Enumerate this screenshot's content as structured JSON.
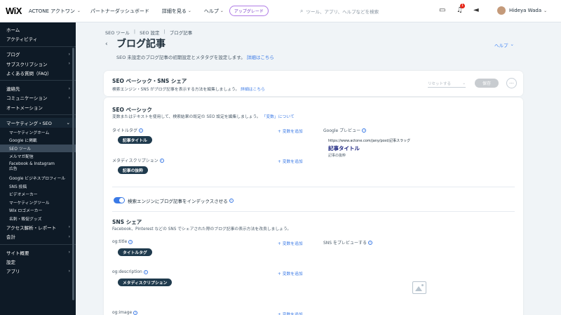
{
  "topbar": {
    "logo": "WiX",
    "site_name": "ACTONE アクトワン",
    "nav": [
      "パートナーダッシュボード",
      "詳細を見る",
      "ヘルプ"
    ],
    "upgrade": "アップグレード",
    "search_placeholder": "ツール、アプリ、ヘルプなどを検索",
    "notification_count": "1",
    "username": "Hideya Wada"
  },
  "sidebar": {
    "top": [
      {
        "label": "ホーム",
        "arrow": ""
      },
      {
        "label": "アクティビティ",
        "arrow": ""
      }
    ],
    "group2": [
      {
        "label": "ブログ",
        "arrow": "›"
      },
      {
        "label": "サブスクリプション",
        "arrow": "›"
      },
      {
        "label": "よくある質問（FAQ）",
        "arrow": ""
      }
    ],
    "group3": [
      {
        "label": "連絡先",
        "arrow": "›"
      },
      {
        "label": "コミュニケーション",
        "arrow": "›"
      },
      {
        "label": "オートメーション",
        "arrow": ""
      }
    ],
    "section": {
      "label": "マーケティング・SEO",
      "arrow": "⌄"
    },
    "sub_items": [
      {
        "label": "マーケティングホーム"
      },
      {
        "label": "Google に掲載"
      },
      {
        "label": "SEO ツール"
      },
      {
        "label": "メルマガ配信"
      },
      {
        "label": "Facebook & Instagram 広告"
      },
      {
        "label": "Google ビジネスプロフィール"
      },
      {
        "label": "SNS 投稿"
      },
      {
        "label": "ビデオメーカー"
      },
      {
        "label": "マーケティングツール"
      },
      {
        "label": "Wix ロゴメーカー"
      },
      {
        "label": "名刺・販促グッズ"
      }
    ],
    "group4": [
      {
        "label": "アクセス解析・レポート",
        "arrow": "›"
      },
      {
        "label": "会計",
        "arrow": "›"
      }
    ],
    "group5": [
      {
        "label": "サイト概要",
        "arrow": "›"
      },
      {
        "label": "設定",
        "arrow": ""
      },
      {
        "label": "アプリ",
        "arrow": "›"
      }
    ]
  },
  "breadcrumb": [
    "SEO ツール",
    "SEO 設定",
    "ブログ記事"
  ],
  "page": {
    "title": "ブログ記事",
    "help": "ヘルプ",
    "subtitle": "SEO 未設定のブログ記事の初期設定とメタタグを設定します。",
    "subtitle_link": "詳細はこちら"
  },
  "top_card": {
    "title": "SEO ベーシック・SNS シェア",
    "desc": "検索エンジン・SNS がブログ記事を表示する方法を編集しましょう。",
    "desc_link": "詳細はこちら",
    "dropdown": "リセットする",
    "save": "保存",
    "more": "···"
  },
  "seo_basic": {
    "title": "SEO ベーシック",
    "desc": "変数またはテキストを使用して、検索結果の既定の SEO 設定を編集しましょう。",
    "desc_link": "「変数」について",
    "title_tag_label": "タイトルタグ",
    "title_tag_value": "記事タイトル",
    "meta_label": "メタディスクリプション",
    "meta_value": "記事の抜粋",
    "add_var": "+ 変数を追加",
    "google_preview_label": "Google プレビュー",
    "preview_url": "https://www.actone.com/jany/post/記事スラッグ",
    "preview_title": "記事タイトル",
    "preview_desc": "記事の抜粋"
  },
  "index_toggle": {
    "label": "検索エンジンにブログ記事をインデックスさせる",
    "checked": "✓"
  },
  "sns": {
    "title": "SNS シェア",
    "desc": "Facebook、Pinterest などの SNS でシェアされた際のブログ記事の表示方法を改良しましょう。",
    "og_title_label": "og:title",
    "og_title_value": "タイトルタグ",
    "og_desc_label": "og:description",
    "og_desc_value": "メタディスクリプション",
    "og_image_label": "og:image",
    "add_var": "+ 変数を追加",
    "preview_label": "SNS をプレビューする"
  },
  "icons": {
    "search": "search-icon",
    "chat": "chat-icon",
    "bell": "bell-icon",
    "megaphone": "megaphone-icon"
  }
}
